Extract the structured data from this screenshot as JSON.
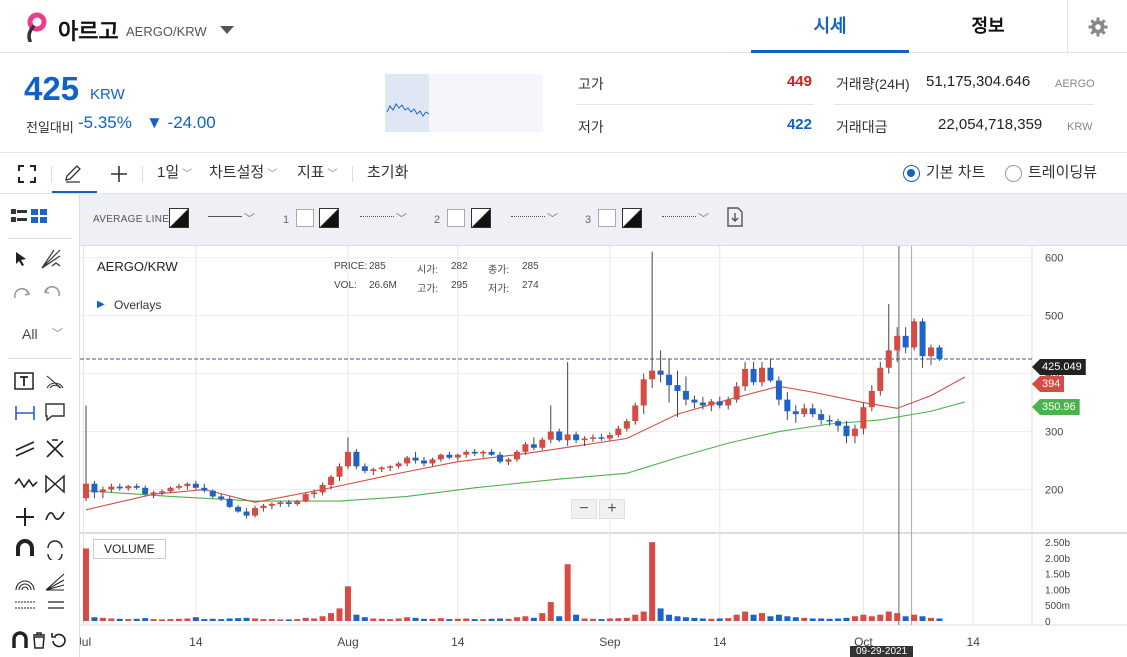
{
  "header": {
    "coin_name": "아르고",
    "coin_pair": "AERGO/KRW",
    "tabs": [
      "시세",
      "정보"
    ]
  },
  "ticker": {
    "price": "425",
    "unit": "KRW",
    "change_label": "전일대비",
    "change_pct": "-5.35%",
    "change_abs": "▼ -24.00",
    "high_label": "고가",
    "high_value": "449",
    "low_label": "저가",
    "low_value": "422",
    "volume_label": "거래량(24H)",
    "volume_value": "51,175,304.646",
    "volume_unit": "AERGO",
    "amount_label": "거래대금",
    "amount_value": "22,054,718,359",
    "amount_unit": "KRW"
  },
  "toolbar": {
    "period": "1일",
    "chart_settings": "차트설정",
    "indicators": "지표",
    "reset": "초기화",
    "basic_chart": "기본 차트",
    "tradingview": "트레이딩뷰",
    "basic_selected": true
  },
  "leftpanel": {
    "filter_label": "All"
  },
  "avgbar": {
    "label": "AVERAGE LINE:",
    "slots": [
      "1",
      "2",
      "3"
    ]
  },
  "chart": {
    "title": "AERGO/KRW",
    "overlays": "Overlays",
    "info": {
      "price_label": "PRICE:",
      "price": "285",
      "open_label": "시가:",
      "open": "282",
      "close_label": "종가:",
      "close": "285",
      "vol_label": "VOL:",
      "vol": "26.6M",
      "high_label": "고가:",
      "high": "295",
      "low_label": "저가:",
      "low": "274"
    },
    "volume_label": "VOLUME",
    "crosshair_date": "09-29-2021",
    "price_tags": {
      "current": "425.049",
      "ma_red": "394",
      "ma_green": "350.96"
    },
    "colors": {
      "up": "#d64b44",
      "down": "#1e64c8",
      "ma_red": "#d64b44",
      "ma_green": "#4cb34c"
    }
  },
  "chart_data": {
    "type": "candlestick",
    "title": "AERGO/KRW",
    "y_ticks": [
      200,
      300,
      400,
      500,
      600
    ],
    "ylim": [
      125,
      620
    ],
    "volume_ticks": [
      "0",
      "500m",
      "1.00b",
      "1.50b",
      "2.00b",
      "2.50b"
    ],
    "volume_ylim": [
      0,
      2600
    ],
    "x_ticks": [
      {
        "label": "Jul",
        "index": -0.3
      },
      {
        "label": "14",
        "index": 13
      },
      {
        "label": "Aug",
        "index": 31
      },
      {
        "label": "14",
        "index": 44
      },
      {
        "label": "Sep",
        "index": 62
      },
      {
        "label": "14",
        "index": 75
      },
      {
        "label": "Oct",
        "index": 92
      },
      {
        "label": "14",
        "index": 105
      }
    ],
    "candles": [
      {
        "o": 185,
        "h": 345,
        "l": 180,
        "c": 210,
        "v": 2300
      },
      {
        "o": 210,
        "h": 215,
        "l": 185,
        "c": 195,
        "v": 120
      },
      {
        "o": 195,
        "h": 205,
        "l": 185,
        "c": 200,
        "v": 100
      },
      {
        "o": 200,
        "h": 210,
        "l": 195,
        "c": 205,
        "v": 80
      },
      {
        "o": 205,
        "h": 210,
        "l": 198,
        "c": 202,
        "v": 70
      },
      {
        "o": 202,
        "h": 208,
        "l": 198,
        "c": 206,
        "v": 60
      },
      {
        "o": 206,
        "h": 210,
        "l": 200,
        "c": 203,
        "v": 70
      },
      {
        "o": 203,
        "h": 207,
        "l": 190,
        "c": 192,
        "v": 90
      },
      {
        "o": 192,
        "h": 198,
        "l": 185,
        "c": 195,
        "v": 60
      },
      {
        "o": 195,
        "h": 200,
        "l": 190,
        "c": 197,
        "v": 50
      },
      {
        "o": 197,
        "h": 205,
        "l": 195,
        "c": 203,
        "v": 60
      },
      {
        "o": 203,
        "h": 210,
        "l": 200,
        "c": 206,
        "v": 70
      },
      {
        "o": 206,
        "h": 212,
        "l": 200,
        "c": 210,
        "v": 80
      },
      {
        "o": 210,
        "h": 215,
        "l": 200,
        "c": 203,
        "v": 120
      },
      {
        "o": 203,
        "h": 210,
        "l": 195,
        "c": 198,
        "v": 60
      },
      {
        "o": 198,
        "h": 200,
        "l": 185,
        "c": 188,
        "v": 70
      },
      {
        "o": 188,
        "h": 192,
        "l": 180,
        "c": 184,
        "v": 60
      },
      {
        "o": 184,
        "h": 188,
        "l": 168,
        "c": 170,
        "v": 80
      },
      {
        "o": 170,
        "h": 173,
        "l": 160,
        "c": 162,
        "v": 90
      },
      {
        "o": 162,
        "h": 168,
        "l": 150,
        "c": 155,
        "v": 100
      },
      {
        "o": 155,
        "h": 172,
        "l": 152,
        "c": 168,
        "v": 80
      },
      {
        "o": 168,
        "h": 175,
        "l": 162,
        "c": 172,
        "v": 60
      },
      {
        "o": 172,
        "h": 178,
        "l": 166,
        "c": 175,
        "v": 60
      },
      {
        "o": 175,
        "h": 180,
        "l": 170,
        "c": 178,
        "v": 50
      },
      {
        "o": 178,
        "h": 182,
        "l": 170,
        "c": 175,
        "v": 50
      },
      {
        "o": 175,
        "h": 182,
        "l": 172,
        "c": 180,
        "v": 60
      },
      {
        "o": 180,
        "h": 195,
        "l": 178,
        "c": 192,
        "v": 100
      },
      {
        "o": 192,
        "h": 200,
        "l": 185,
        "c": 195,
        "v": 80
      },
      {
        "o": 195,
        "h": 212,
        "l": 190,
        "c": 208,
        "v": 150
      },
      {
        "o": 208,
        "h": 225,
        "l": 200,
        "c": 222,
        "v": 250
      },
      {
        "o": 222,
        "h": 245,
        "l": 215,
        "c": 240,
        "v": 400
      },
      {
        "o": 240,
        "h": 290,
        "l": 235,
        "c": 265,
        "v": 1100
      },
      {
        "o": 265,
        "h": 270,
        "l": 235,
        "c": 240,
        "v": 200
      },
      {
        "o": 240,
        "h": 245,
        "l": 228,
        "c": 232,
        "v": 120
      },
      {
        "o": 232,
        "h": 238,
        "l": 225,
        "c": 235,
        "v": 80
      },
      {
        "o": 235,
        "h": 240,
        "l": 230,
        "c": 238,
        "v": 70
      },
      {
        "o": 238,
        "h": 242,
        "l": 232,
        "c": 240,
        "v": 60
      },
      {
        "o": 240,
        "h": 248,
        "l": 236,
        "c": 245,
        "v": 80
      },
      {
        "o": 245,
        "h": 258,
        "l": 240,
        "c": 255,
        "v": 120
      },
      {
        "o": 255,
        "h": 265,
        "l": 245,
        "c": 250,
        "v": 100
      },
      {
        "o": 250,
        "h": 256,
        "l": 240,
        "c": 245,
        "v": 70
      },
      {
        "o": 245,
        "h": 255,
        "l": 240,
        "c": 252,
        "v": 70
      },
      {
        "o": 252,
        "h": 262,
        "l": 248,
        "c": 260,
        "v": 90
      },
      {
        "o": 260,
        "h": 265,
        "l": 252,
        "c": 255,
        "v": 60
      },
      {
        "o": 255,
        "h": 262,
        "l": 250,
        "c": 260,
        "v": 70
      },
      {
        "o": 260,
        "h": 268,
        "l": 255,
        "c": 265,
        "v": 80
      },
      {
        "o": 265,
        "h": 270,
        "l": 258,
        "c": 262,
        "v": 60
      },
      {
        "o": 262,
        "h": 268,
        "l": 255,
        "c": 265,
        "v": 60
      },
      {
        "o": 265,
        "h": 270,
        "l": 258,
        "c": 260,
        "v": 70
      },
      {
        "o": 260,
        "h": 265,
        "l": 245,
        "c": 248,
        "v": 80
      },
      {
        "o": 248,
        "h": 255,
        "l": 242,
        "c": 252,
        "v": 70
      },
      {
        "o": 252,
        "h": 268,
        "l": 248,
        "c": 265,
        "v": 120
      },
      {
        "o": 265,
        "h": 282,
        "l": 260,
        "c": 278,
        "v": 150
      },
      {
        "o": 278,
        "h": 290,
        "l": 268,
        "c": 272,
        "v": 100
      },
      {
        "o": 272,
        "h": 290,
        "l": 268,
        "c": 286,
        "v": 250
      },
      {
        "o": 286,
        "h": 345,
        "l": 280,
        "c": 300,
        "v": 600
      },
      {
        "o": 300,
        "h": 305,
        "l": 282,
        "c": 285,
        "v": 150
      },
      {
        "o": 285,
        "h": 420,
        "l": 275,
        "c": 295,
        "v": 1800
      },
      {
        "o": 295,
        "h": 300,
        "l": 280,
        "c": 285,
        "v": 200
      },
      {
        "o": 285,
        "h": 292,
        "l": 275,
        "c": 288,
        "v": 80
      },
      {
        "o": 288,
        "h": 295,
        "l": 282,
        "c": 290,
        "v": 70
      },
      {
        "o": 290,
        "h": 296,
        "l": 284,
        "c": 288,
        "v": 60
      },
      {
        "o": 288,
        "h": 298,
        "l": 283,
        "c": 294,
        "v": 80
      },
      {
        "o": 294,
        "h": 310,
        "l": 290,
        "c": 305,
        "v": 90
      },
      {
        "o": 305,
        "h": 322,
        "l": 300,
        "c": 318,
        "v": 100
      },
      {
        "o": 318,
        "h": 350,
        "l": 312,
        "c": 345,
        "v": 200
      },
      {
        "o": 345,
        "h": 400,
        "l": 330,
        "c": 390,
        "v": 300
      },
      {
        "o": 390,
        "h": 610,
        "l": 375,
        "c": 405,
        "v": 2500
      },
      {
        "o": 405,
        "h": 440,
        "l": 385,
        "c": 398,
        "v": 400
      },
      {
        "o": 398,
        "h": 425,
        "l": 350,
        "c": 380,
        "v": 200
      },
      {
        "o": 380,
        "h": 405,
        "l": 325,
        "c": 370,
        "v": 150
      },
      {
        "o": 370,
        "h": 395,
        "l": 345,
        "c": 355,
        "v": 120
      },
      {
        "o": 355,
        "h": 362,
        "l": 340,
        "c": 350,
        "v": 100
      },
      {
        "o": 350,
        "h": 360,
        "l": 338,
        "c": 345,
        "v": 80
      },
      {
        "o": 345,
        "h": 356,
        "l": 335,
        "c": 352,
        "v": 70
      },
      {
        "o": 352,
        "h": 360,
        "l": 340,
        "c": 345,
        "v": 80
      },
      {
        "o": 345,
        "h": 360,
        "l": 338,
        "c": 355,
        "v": 90
      },
      {
        "o": 355,
        "h": 385,
        "l": 350,
        "c": 378,
        "v": 200
      },
      {
        "o": 378,
        "h": 420,
        "l": 370,
        "c": 408,
        "v": 300
      },
      {
        "o": 408,
        "h": 420,
        "l": 380,
        "c": 385,
        "v": 200
      },
      {
        "o": 385,
        "h": 420,
        "l": 378,
        "c": 410,
        "v": 250
      },
      {
        "o": 410,
        "h": 425,
        "l": 385,
        "c": 388,
        "v": 150
      },
      {
        "o": 388,
        "h": 395,
        "l": 345,
        "c": 355,
        "v": 200
      },
      {
        "o": 355,
        "h": 368,
        "l": 320,
        "c": 335,
        "v": 150
      },
      {
        "o": 335,
        "h": 345,
        "l": 315,
        "c": 330,
        "v": 120
      },
      {
        "o": 330,
        "h": 348,
        "l": 325,
        "c": 340,
        "v": 100
      },
      {
        "o": 340,
        "h": 348,
        "l": 325,
        "c": 330,
        "v": 80
      },
      {
        "o": 330,
        "h": 338,
        "l": 312,
        "c": 320,
        "v": 80
      },
      {
        "o": 320,
        "h": 328,
        "l": 310,
        "c": 318,
        "v": 70
      },
      {
        "o": 318,
        "h": 322,
        "l": 300,
        "c": 310,
        "v": 80
      },
      {
        "o": 310,
        "h": 318,
        "l": 280,
        "c": 292,
        "v": 100
      },
      {
        "o": 292,
        "h": 312,
        "l": 280,
        "c": 305,
        "v": 150
      },
      {
        "o": 305,
        "h": 350,
        "l": 295,
        "c": 342,
        "v": 200
      },
      {
        "o": 342,
        "h": 380,
        "l": 335,
        "c": 370,
        "v": 150
      },
      {
        "o": 370,
        "h": 420,
        "l": 362,
        "c": 410,
        "v": 200
      },
      {
        "o": 410,
        "h": 520,
        "l": 400,
        "c": 440,
        "v": 300
      },
      {
        "o": 440,
        "h": 480,
        "l": 420,
        "c": 465,
        "v": 250
      },
      {
        "o": 465,
        "h": 480,
        "l": 435,
        "c": 445,
        "v": 150
      },
      {
        "o": 445,
        "h": 495,
        "l": 440,
        "c": 490,
        "v": 200
      },
      {
        "o": 490,
        "h": 495,
        "l": 410,
        "c": 430,
        "v": 150
      },
      {
        "o": 430,
        "h": 450,
        "l": 415,
        "c": 445,
        "v": 100
      },
      {
        "o": 445,
        "h": 449,
        "l": 422,
        "c": 425,
        "v": 80
      }
    ],
    "ma_red": [
      {
        "i": 0,
        "y": 165
      },
      {
        "i": 8,
        "y": 192
      },
      {
        "i": 14,
        "y": 200
      },
      {
        "i": 20,
        "y": 178
      },
      {
        "i": 28,
        "y": 200
      },
      {
        "i": 36,
        "y": 225
      },
      {
        "i": 44,
        "y": 248
      },
      {
        "i": 52,
        "y": 262
      },
      {
        "i": 58,
        "y": 275
      },
      {
        "i": 64,
        "y": 288
      },
      {
        "i": 70,
        "y": 330
      },
      {
        "i": 76,
        "y": 355
      },
      {
        "i": 82,
        "y": 378
      },
      {
        "i": 86,
        "y": 368
      },
      {
        "i": 92,
        "y": 350
      },
      {
        "i": 96,
        "y": 340
      },
      {
        "i": 100,
        "y": 362
      },
      {
        "i": 104,
        "y": 394
      }
    ],
    "ma_green": [
      {
        "i": 0,
        "y": 198
      },
      {
        "i": 10,
        "y": 188
      },
      {
        "i": 20,
        "y": 180
      },
      {
        "i": 30,
        "y": 180
      },
      {
        "i": 38,
        "y": 188
      },
      {
        "i": 46,
        "y": 203
      },
      {
        "i": 56,
        "y": 218
      },
      {
        "i": 64,
        "y": 228
      },
      {
        "i": 70,
        "y": 255
      },
      {
        "i": 76,
        "y": 280
      },
      {
        "i": 82,
        "y": 300
      },
      {
        "i": 88,
        "y": 313
      },
      {
        "i": 94,
        "y": 320
      },
      {
        "i": 100,
        "y": 335
      },
      {
        "i": 104,
        "y": 351
      }
    ]
  }
}
